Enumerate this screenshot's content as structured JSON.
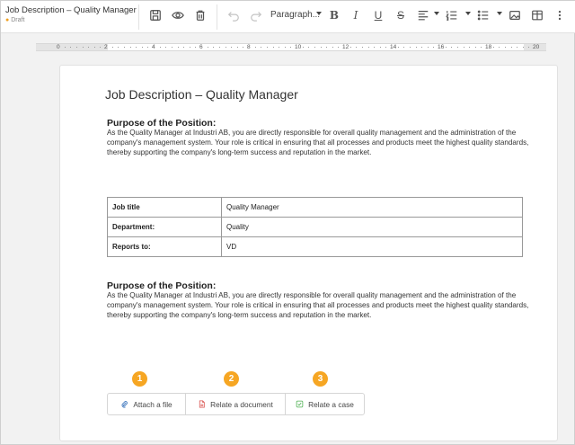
{
  "header": {
    "title": "Job Description – Quality Manager",
    "status": "Draft"
  },
  "toolbar": {
    "icons": [
      "save-icon",
      "preview-eye-icon",
      "delete-trash-icon",
      "undo-icon",
      "redo-icon",
      "bold-icon",
      "italic-icon",
      "underline-icon",
      "strikethrough-icon",
      "align-left-icon",
      "numbered-list-icon",
      "bullet-list-icon",
      "image-icon",
      "table-icon",
      "more-vertical-icon"
    ],
    "paragraph_style": "Paragraph...",
    "bold": "B",
    "italic": "I",
    "underline": "U",
    "strike": "S"
  },
  "ruler": {
    "marks": [
      "0",
      "2",
      "4",
      "6",
      "8",
      "10",
      "12",
      "14",
      "16",
      "18",
      "20"
    ]
  },
  "document": {
    "heading": "Job Description – Quality Manager",
    "section1": {
      "title": "Purpose of the Position:",
      "body": "As the Quality Manager at Industri AB, you are directly responsible for overall quality management and the administration of the company's management system. Your role is critical in ensuring that all processes and products meet the highest quality standards, thereby supporting the company's long-term success and reputation in the market."
    },
    "table": [
      {
        "key": "Job title",
        "value": "Quality Manager"
      },
      {
        "key": "Department:",
        "value": "Quality"
      },
      {
        "key": "Reports to:",
        "value": "VD"
      }
    ],
    "section2": {
      "title": "Purpose of the Position:",
      "body": "As the Quality Manager at Industri AB, you are directly responsible for overall quality management and the administration of the company's management system. Your role is critical in ensuring that all processes and products meet the highest quality standards, thereby supporting the company's long-term success and reputation in the market."
    }
  },
  "callouts": [
    "1",
    "2",
    "3"
  ],
  "actions": {
    "attach": "Attach a file",
    "relate_document": "Relate a document",
    "relate_case": "Relate a case"
  },
  "colors": {
    "accent": "#f6a623",
    "draft_dot": "#f0a020",
    "document_icon": "#d9534f",
    "case_icon": "#4caf50",
    "attach_icon": "#4a7fc1"
  }
}
